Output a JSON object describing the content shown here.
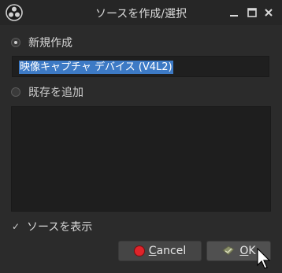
{
  "window": {
    "title": "ソースを作成/選択"
  },
  "create_new": {
    "label": "新規作成",
    "selected": true,
    "name_value": "映像キャプチャ デバイス (V4L2)"
  },
  "add_existing": {
    "label": "既存を追加",
    "selected": false,
    "items": []
  },
  "show_sources": {
    "label": "ソースを表示",
    "checked": true,
    "mark": "✓"
  },
  "buttons": {
    "cancel_first": "C",
    "cancel_rest": "ancel",
    "ok_first": "O",
    "ok_rest": "K"
  },
  "icons": {
    "app": "obs-logo-icon",
    "minimize": "minimize-icon",
    "maximize": "maximize-icon",
    "close": "close-icon",
    "cancel": "cancel-circle-icon",
    "ok": "ok-check-icon",
    "cursor": "mouse-pointer-icon"
  },
  "colors": {
    "window_bg": "#2b2b2b",
    "selection": "#3d7ac5",
    "cancel_red": "#e0242a"
  }
}
